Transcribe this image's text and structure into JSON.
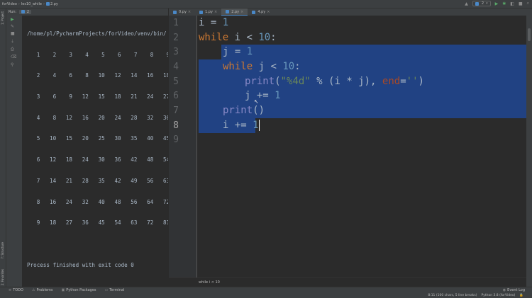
{
  "window": {
    "breadcrumbs": [
      "forVideo",
      "les10_while",
      "2.py"
    ],
    "run_config": "2",
    "event_log": "Event Log"
  },
  "run_panel": {
    "label": "Run:",
    "tab": "2",
    "console": {
      "path": "/home/pl/PycharmProjects/forVideo/venv/bin/",
      "rows": [
        "   1    2    3    4    5    6    7    8    9",
        "   2    4    6    8   10   12   14   16   18",
        "   3    6    9   12   15   18   21   24   27",
        "   4    8   12   16   20   24   28   32   36",
        "   5   10   15   20   25   30   35   40   45",
        "   6   12   18   24   30   36   42   48   54",
        "   7   14   21   28   35   42   49   56   63",
        "   8   16   24   32   40   48   56   64   72",
        "   9   18   27   36   45   54   63   72   81"
      ],
      "finished": "Process finished with exit code 0"
    }
  },
  "left_strip": {
    "project": "1: Project",
    "structure": "7: Structure",
    "favorites": "2: Favorites"
  },
  "editor": {
    "tabs": [
      {
        "label": "0.py",
        "active": false
      },
      {
        "label": "1.py",
        "active": false
      },
      {
        "label": "2.py",
        "active": true
      },
      {
        "label": "4.py",
        "active": false
      }
    ],
    "line_numbers": [
      "1",
      "2",
      "3",
      "4",
      "5",
      "6",
      "7",
      "8",
      "9"
    ],
    "code": {
      "l1_var": "i",
      "l1_eq": " = ",
      "l1_num": "1",
      "l2_kw": "while",
      "l2_rest": " i < ",
      "l2_num": "10",
      "l2_colon": ":",
      "l3_var": "j",
      "l3_eq": " = ",
      "l3_num": "1",
      "l4_kw": "while",
      "l4_rest": " j < ",
      "l4_num": "10",
      "l4_colon": ":",
      "l5_fn": "print",
      "l5_open": "(",
      "l5_str": "\"%4d\"",
      "l5_mid": " % (i * j), ",
      "l5_kwarg": "end",
      "l5_eq": "=",
      "l5_str2": "''",
      "l5_close": ")",
      "l6_var": "j",
      "l6_op": " += ",
      "l6_num": "1",
      "l7_fn": "print",
      "l7_paren": "()",
      "l8_var": "i",
      "l8_op": " += ",
      "l8_num": "1"
    },
    "context_crumb": "while i < 10"
  },
  "bottom_tools": [
    "TODO",
    "Problems",
    "Python Packages",
    "Terminal"
  ],
  "status": {
    "caret": "8:11 (100 chars, 5 line breaks)",
    "interpreter": "Python 3.8 (forVideo)"
  },
  "colors": {
    "selection": "#214283",
    "keyword": "#cc7832",
    "number": "#6897bb",
    "string": "#6a8759",
    "builtin": "#8888c6"
  }
}
